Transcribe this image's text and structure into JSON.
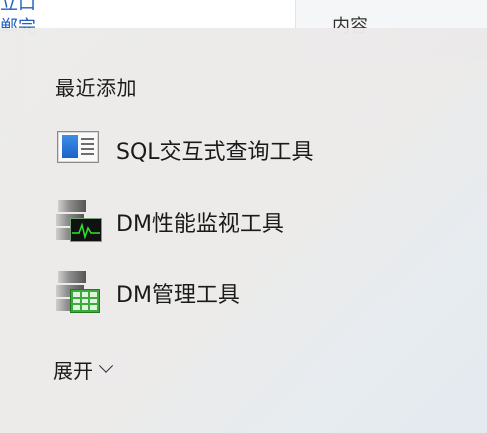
{
  "background": {
    "left_text_lines": [
      "立口",
      "郸完"
    ],
    "right_label": "内容"
  },
  "start_menu": {
    "section_title": "最近添加",
    "apps": [
      {
        "label": "SQL交互式查询工具",
        "icon": "sql-query-tool-icon"
      },
      {
        "label": "DM性能监视工具",
        "icon": "performance-monitor-icon"
      },
      {
        "label": "DM管理工具",
        "icon": "management-tool-icon"
      }
    ],
    "expand_label": "展开"
  },
  "colors": {
    "accent_blue": "#1f5fbf",
    "monitor_green": "#3cab3c"
  }
}
